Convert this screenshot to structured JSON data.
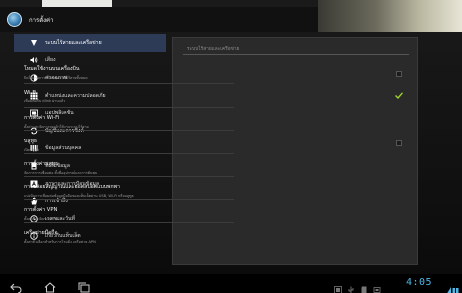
{
  "app": {
    "title": "การตั้งค่า"
  },
  "sidebar": {
    "items": [
      {
        "label": "ระบบไร้สายและเครือข่าย",
        "icon": "wifi-icon",
        "active": true
      },
      {
        "label": "เสียง",
        "icon": "speaker-icon"
      },
      {
        "label": "ค่าจอภาพ",
        "icon": "brightness-icon"
      },
      {
        "label": "ตำแหน่งและความปลอดภัย",
        "icon": "grid-icon"
      },
      {
        "label": "แอปพลิเคชัน",
        "icon": "apps-icon"
      },
      {
        "label": "บัญชีและการซิงค์",
        "icon": "sync-icon"
      },
      {
        "label": "ข้อมูลส่วนบุคคล",
        "icon": "bars-icon"
      },
      {
        "label": "ที่เก็บข้อมูล",
        "icon": "storage-icon"
      },
      {
        "label": "ภาษาและการป้อนข้อมูล",
        "icon": "keyboard-icon"
      },
      {
        "label": "การเข้าถึง",
        "icon": "hand-icon"
      },
      {
        "label": "เวลาและวันที่",
        "icon": "clock-icon"
      },
      {
        "label": "เกี่ยวกับแท็บเล็ต",
        "icon": "info-icon"
      }
    ]
  },
  "panel": {
    "header": "ระบบไร้สายและเครือข่าย",
    "prefs": [
      {
        "title": "โหมดใช้งานบนเครื่องบิน",
        "summary": "ปิดใช้งานการเชื่อมต่อระบบไร้สายทั้งหมด",
        "checkbox": true,
        "checked": false
      },
      {
        "title": "Wi-Fi",
        "summary": "เชื่อมต่อกับ dlink ผ่านแล้ว",
        "checkbox": true,
        "checked": true
      },
      {
        "title": "การตั้งค่า Wi-Fi",
        "summary": "ตั้งค่าและจัดการจุดเข้าใช้งานระบบไร้สาย",
        "checkbox": false
      },
      {
        "title": "บลูทูธ",
        "summary": "เปิดบลูทูธ",
        "checkbox": true,
        "checked": false
      },
      {
        "title": "การตั้งค่าบลูทูธ",
        "summary": "จัดการการเชื่อมต่อ ตั้งชื่ออุปกรณ์และการค้นพบ",
        "checkbox": false
      },
      {
        "title": "การปล่อยสัญญาณและฮอตสปอตแบบพกพา",
        "summary": "แบ่งปันการเชื่อมต่อข้อมูลมือถือของแท็บเล็ตผ่าน USB, Wi-Fi หรือบลูทูธ",
        "checkbox": false
      },
      {
        "title": "การตั้งค่า VPN",
        "summary": "ตั้งค่าและจัดการ VPN",
        "checkbox": false
      },
      {
        "title": "เครือข่ายมือถือ",
        "summary": "ตั้งค่าตัวเลือกสำหรับการโรมมิ่ง เครือข่าย APN",
        "checkbox": false
      }
    ]
  },
  "status": {
    "time": "4:05",
    "accent": "#4fb8e6"
  }
}
